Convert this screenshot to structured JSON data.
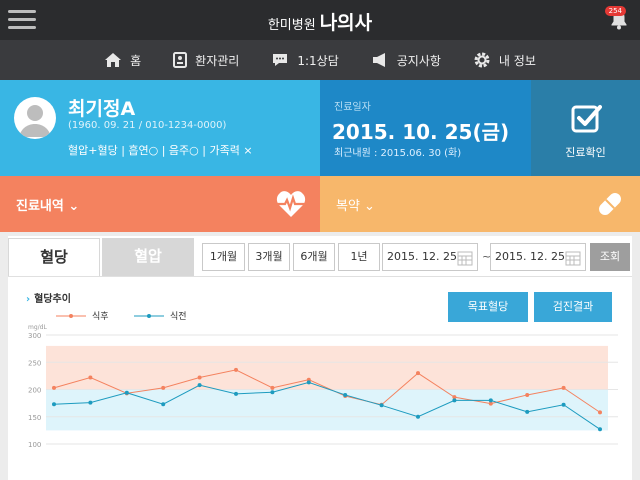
{
  "header": {
    "hospital": "한미병원",
    "app_name": "나의사",
    "notification_count": "254"
  },
  "nav": {
    "items": [
      {
        "label": "홈",
        "icon": "home-icon"
      },
      {
        "label": "환자관리",
        "icon": "patient-card-icon"
      },
      {
        "label": "1:1상담",
        "icon": "chat-icon"
      },
      {
        "label": "공지사항",
        "icon": "megaphone-icon"
      },
      {
        "label": "내 정보",
        "icon": "gear-icon"
      }
    ]
  },
  "patient": {
    "name": "최기정A",
    "info": "(1960. 09. 21 / 010-1234-0000)",
    "habits": "혈압+혈당 | 흡연○ | 음주○ | 가족력 ×"
  },
  "visit": {
    "label": "진료일자",
    "date": "2015. 10. 25(금)",
    "recent": "최근내원 : 2015.06. 30 (화)"
  },
  "confirm": {
    "label": "진료확인"
  },
  "sections": {
    "history": "진료내역",
    "medication": "복약"
  },
  "tabs": {
    "glucose": "혈당",
    "pressure": "혈압"
  },
  "periods": [
    "1개월",
    "3개월",
    "6개월",
    "1년"
  ],
  "date_range": {
    "start": "2015. 12. 25",
    "end": "2015. 12. 25",
    "separator": "~"
  },
  "search_label": "조회",
  "buttons": {
    "target": "목표혈당",
    "checkup": "검진결과"
  },
  "chart_data": {
    "type": "line",
    "title": "혈당추이",
    "ylabel": "mg/dL",
    "ylim": [
      100,
      300
    ],
    "y_ticks": [
      100,
      150,
      200,
      250,
      300
    ],
    "bands": [
      {
        "from": 200,
        "to": 280,
        "color": "#fde3d9"
      },
      {
        "from": 125,
        "to": 200,
        "color": "#def4fb"
      }
    ],
    "series": [
      {
        "name": "식후",
        "color": "#f4825f",
        "values": [
          203,
          222,
          193,
          203,
          222,
          236,
          203,
          218,
          188,
          172,
          230,
          186,
          174,
          190,
          203,
          158
        ]
      },
      {
        "name": "식전",
        "color": "#1d9bbf",
        "values": [
          173,
          176,
          194,
          173,
          208,
          192,
          195,
          213,
          190,
          171,
          150,
          180,
          180,
          159,
          172,
          127
        ]
      }
    ]
  }
}
